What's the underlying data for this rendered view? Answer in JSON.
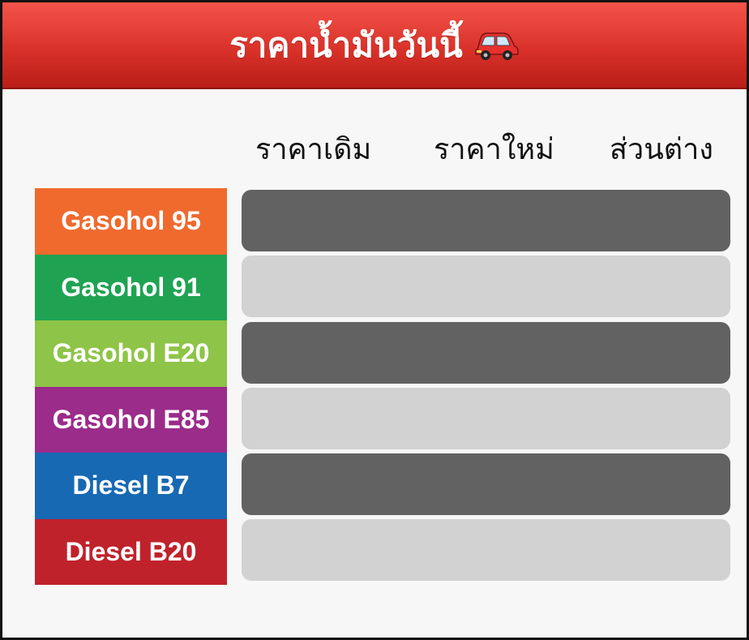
{
  "header": {
    "title": "ราคาน้ำมันวันนี้",
    "icon": "car-icon"
  },
  "columns": {
    "old_price": "ราคาเดิม",
    "new_price": "ราคาใหม่",
    "difference": "ส่วนต่าง"
  },
  "fuels": [
    {
      "label": "Gasohol 95",
      "color": "#f06a2e",
      "row_color": "#626262",
      "old_price": "",
      "new_price": "",
      "difference": ""
    },
    {
      "label": "Gasohol 91",
      "color": "#1fa353",
      "row_color": "#d2d2d2",
      "old_price": "",
      "new_price": "",
      "difference": ""
    },
    {
      "label": "Gasohol E20",
      "color": "#8ec447",
      "row_color": "#626262",
      "old_price": "",
      "new_price": "",
      "difference": ""
    },
    {
      "label": "Gasohol E85",
      "color": "#9b2c8a",
      "row_color": "#d2d2d2",
      "old_price": "",
      "new_price": "",
      "difference": ""
    },
    {
      "label": "Diesel B7",
      "color": "#1769b3",
      "row_color": "#626262",
      "old_price": "",
      "new_price": "",
      "difference": ""
    },
    {
      "label": "Diesel B20",
      "color": "#c0222b",
      "row_color": "#d2d2d2",
      "old_price": "",
      "new_price": "",
      "difference": ""
    }
  ],
  "colors": {
    "header_top": "#f4544a",
    "header_bottom": "#b81e17",
    "panel_bg": "#f7f7f7",
    "border": "#111111"
  }
}
